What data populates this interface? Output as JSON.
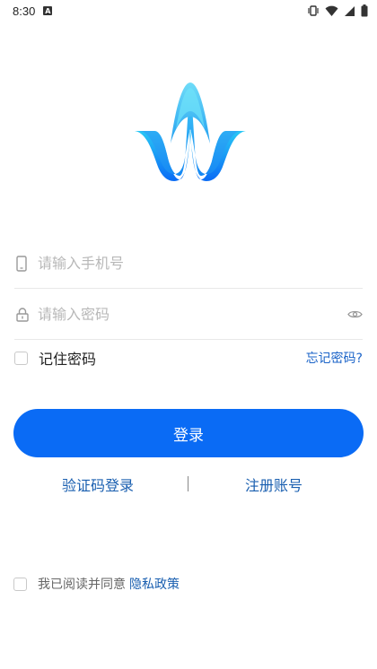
{
  "status_bar": {
    "time": "8:30",
    "notification_badge": "A",
    "icons": [
      "vibrate-icon",
      "wifi-icon",
      "cell-signal-icon",
      "battery-icon"
    ]
  },
  "logo": {
    "name": "app-logo",
    "colors": [
      "#1fb2f0",
      "#0a6bf5"
    ]
  },
  "login_form": {
    "phone_placeholder": "请输入手机号",
    "password_placeholder": "请输入密码",
    "phone_icon": "phone-icon",
    "lock_icon": "lock-icon",
    "eye_icon": "eye-icon"
  },
  "remember": {
    "label": "记住密码",
    "checked": false,
    "forgot_label": "忘记密码?"
  },
  "login_button": {
    "label": "登录",
    "color": "#0a6bf5"
  },
  "alt_links": {
    "sms_login": "验证码登录",
    "register": "注册账号"
  },
  "agreement": {
    "text": "我已阅读并同意",
    "policy_link": "隐私政策",
    "checked": false
  }
}
